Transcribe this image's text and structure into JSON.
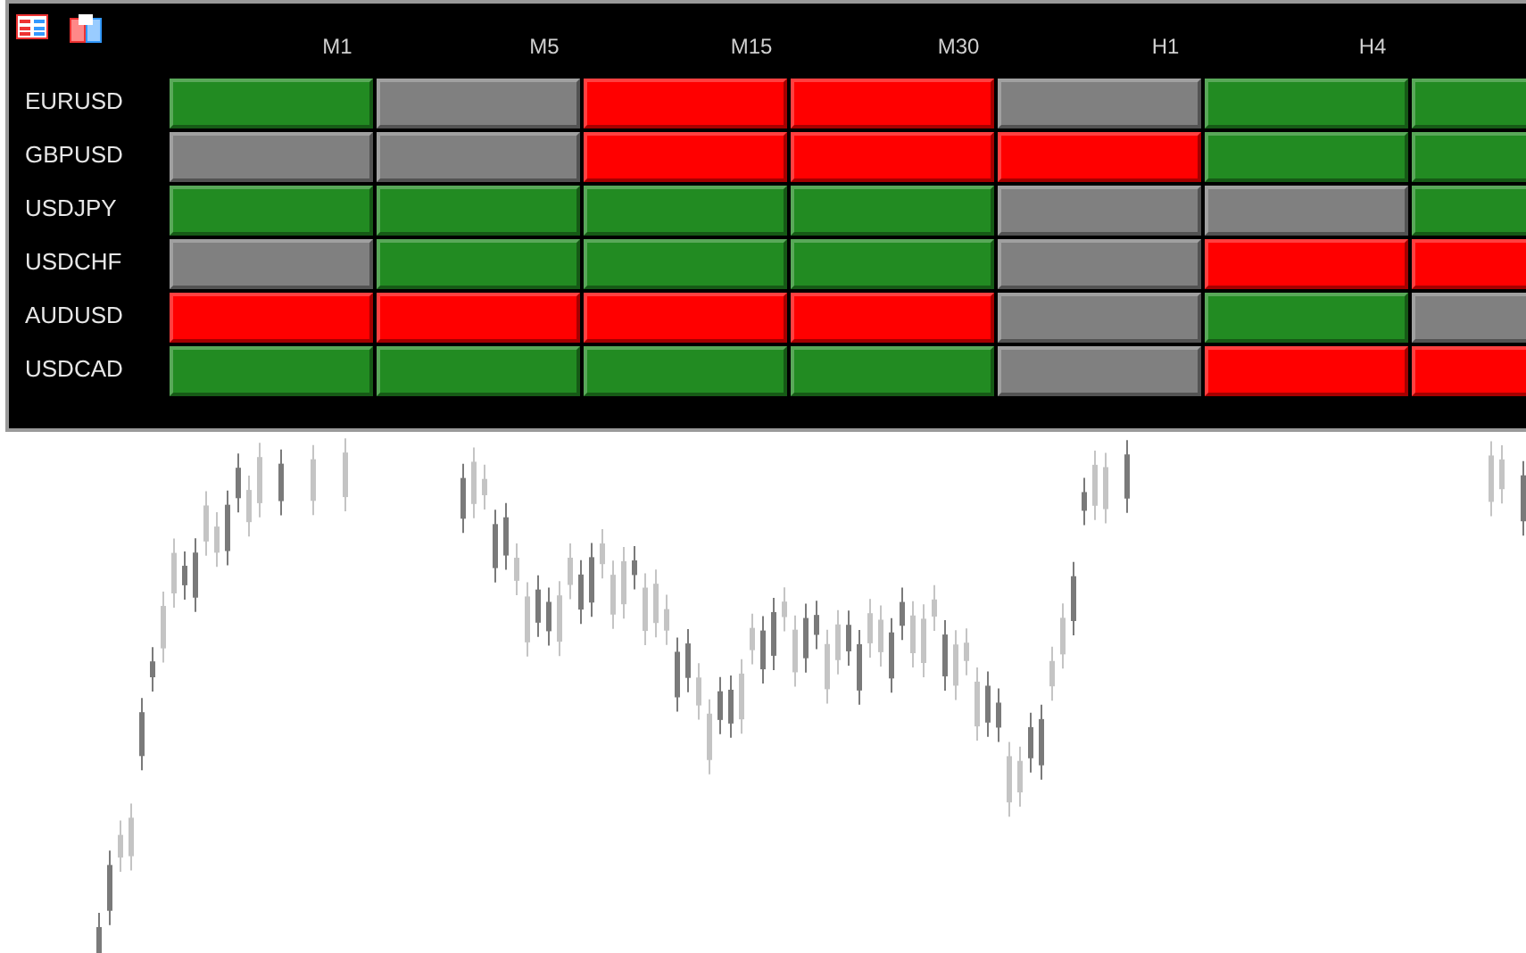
{
  "columns": [
    "M1",
    "M5",
    "M15",
    "M30",
    "H1",
    "H4"
  ],
  "rows": [
    {
      "symbol": "EURUSD",
      "cells": [
        {
          "color": "#228b22"
        },
        {
          "color": "#808080"
        },
        {
          "color": "#ff0000"
        },
        {
          "color": "#ff0000"
        },
        {
          "color": "#808080"
        },
        {
          "color": "#228b22"
        },
        {
          "color": "#228b22"
        }
      ]
    },
    {
      "symbol": "GBPUSD",
      "cells": [
        {
          "color": "#808080"
        },
        {
          "color": "#808080"
        },
        {
          "color": "#ff0000"
        },
        {
          "color": "#ff0000"
        },
        {
          "color": "#ff0000"
        },
        {
          "color": "#228b22"
        },
        {
          "color": "#228b22"
        }
      ]
    },
    {
      "symbol": "USDJPY",
      "cells": [
        {
          "color": "#228b22"
        },
        {
          "color": "#228b22"
        },
        {
          "color": "#228b22"
        },
        {
          "color": "#228b22"
        },
        {
          "color": "#808080"
        },
        {
          "color": "#808080"
        },
        {
          "color": "#228b22"
        }
      ]
    },
    {
      "symbol": "USDCHF",
      "cells": [
        {
          "color": "#808080"
        },
        {
          "color": "#228b22"
        },
        {
          "color": "#228b22"
        },
        {
          "color": "#228b22"
        },
        {
          "color": "#808080"
        },
        {
          "color": "#ff0000"
        },
        {
          "color": "#ff0000"
        }
      ]
    },
    {
      "symbol": "AUDUSD",
      "cells": [
        {
          "color": "#ff0000"
        },
        {
          "color": "#ff0000"
        },
        {
          "color": "#ff0000"
        },
        {
          "color": "#ff0000"
        },
        {
          "color": "#808080"
        },
        {
          "color": "#228b22"
        },
        {
          "color": "#808080"
        }
      ]
    },
    {
      "symbol": "USDCAD",
      "cells": [
        {
          "color": "#228b22"
        },
        {
          "color": "#228b22"
        },
        {
          "color": "#228b22"
        },
        {
          "color": "#228b22"
        },
        {
          "color": "#808080"
        },
        {
          "color": "#ff0000"
        },
        {
          "color": "#ff0000"
        }
      ]
    }
  ]
}
